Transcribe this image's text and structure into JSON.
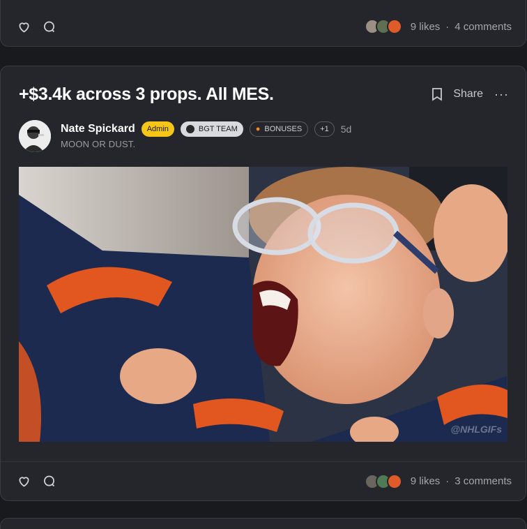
{
  "posts": [
    {
      "footer": {
        "likes": "9 likes",
        "separator": "·",
        "comments": "4 comments"
      },
      "reactor_colors": [
        "#9b8f85",
        "#5e6f52",
        "#e05b2a"
      ]
    },
    {
      "title": "+$3.4k across 3 props. All MES.",
      "share_label": "Share",
      "more_label": "···",
      "author": {
        "name": "Nate Spickard",
        "tagline": "MOON OR DUST.",
        "badges": {
          "admin": "Admin",
          "team": "BGT TEAM",
          "bonuses": "BONUSES",
          "more": "+1"
        },
        "time": "5d"
      },
      "media": {
        "watermark": "@NHLGIFs"
      },
      "footer": {
        "likes": "9 likes",
        "separator": "·",
        "comments": "3 comments"
      },
      "reactor_colors": [
        "#6b6560",
        "#4f7a56",
        "#e05b2a"
      ]
    }
  ],
  "colors": {
    "background": "#191a1d",
    "card": "#24262b",
    "admin_badge": "#f5c518",
    "team_badge": "#d9dadd"
  }
}
